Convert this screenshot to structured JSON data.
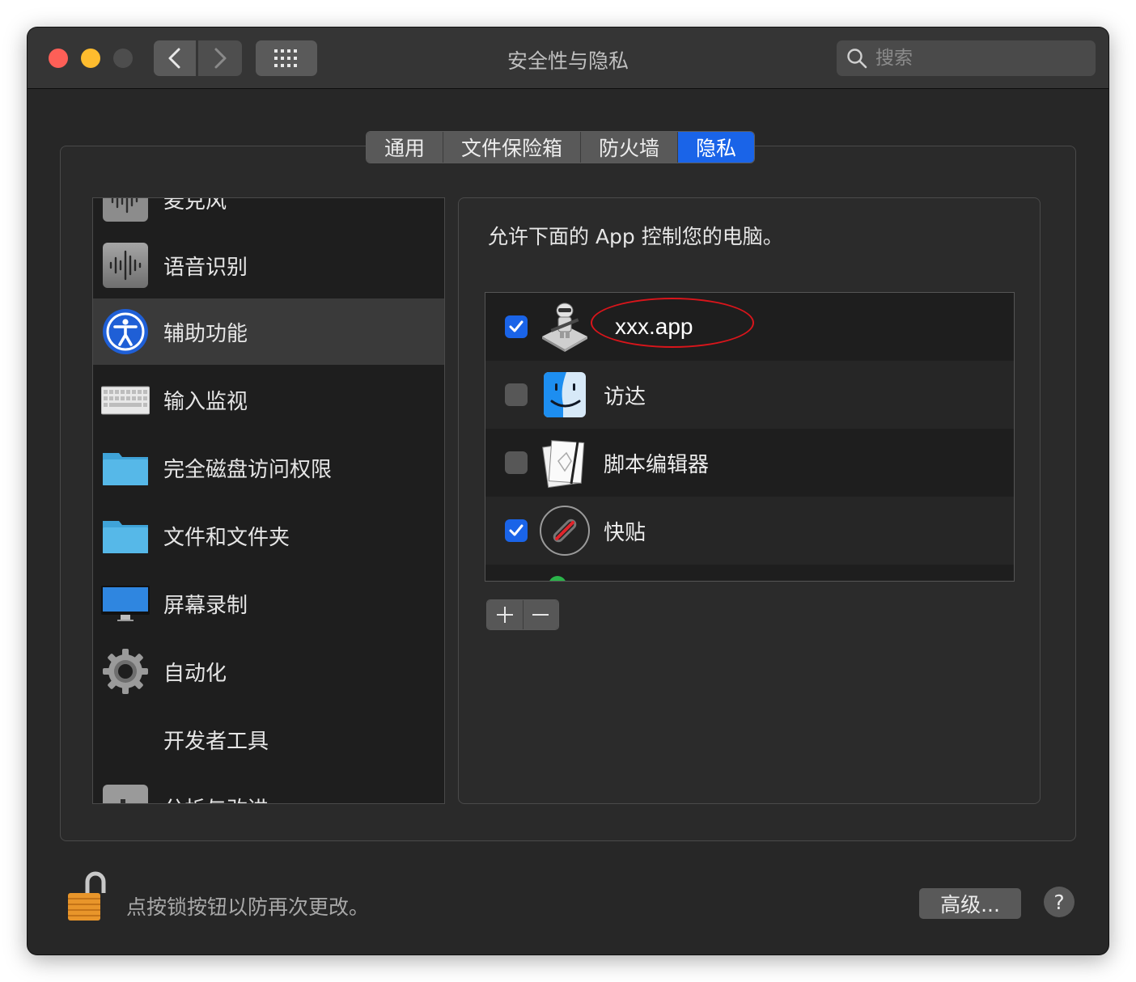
{
  "window": {
    "title": "安全性与隐私"
  },
  "search": {
    "placeholder": "搜索"
  },
  "tabs": [
    {
      "label": "通用",
      "active": false
    },
    {
      "label": "文件保险箱",
      "active": false
    },
    {
      "label": "防火墙",
      "active": false
    },
    {
      "label": "隐私",
      "active": true
    }
  ],
  "sidebar": {
    "items": [
      {
        "label": "麦克风",
        "icon": "microphone-icon",
        "selected": false
      },
      {
        "label": "语音识别",
        "icon": "speech-recognition-icon",
        "selected": false
      },
      {
        "label": "辅助功能",
        "icon": "accessibility-icon",
        "selected": true
      },
      {
        "label": "输入监视",
        "icon": "keyboard-icon",
        "selected": false
      },
      {
        "label": "完全磁盘访问权限",
        "icon": "folder-icon",
        "selected": false
      },
      {
        "label": "文件和文件夹",
        "icon": "folder-icon",
        "selected": false
      },
      {
        "label": "屏幕录制",
        "icon": "display-icon",
        "selected": false
      },
      {
        "label": "自动化",
        "icon": "gear-icon",
        "selected": false
      },
      {
        "label": "开发者工具",
        "icon": "",
        "selected": false
      },
      {
        "label": "分析与改进",
        "icon": "analytics-icon",
        "selected": false
      }
    ]
  },
  "panel": {
    "heading": "允许下面的 App 控制您的电脑。",
    "apps": [
      {
        "name": "xxx.app",
        "checked": true,
        "icon": "automator-icon",
        "annotated": true
      },
      {
        "name": "访达",
        "checked": false,
        "icon": "finder-icon",
        "annotated": false
      },
      {
        "name": "脚本编辑器",
        "checked": false,
        "icon": "script-editor-icon",
        "annotated": false
      },
      {
        "name": "快贴",
        "checked": true,
        "icon": "clipboard-app-icon",
        "annotated": false
      }
    ],
    "add_label": "+",
    "remove_label": "−"
  },
  "footer": {
    "lock_text": "点按锁按钮以防再次更改。",
    "advanced_label": "高级...",
    "help_label": "?"
  },
  "colors": {
    "accent": "#1a64e8",
    "window_bg": "#272727",
    "annotation_red": "#d9151b"
  }
}
